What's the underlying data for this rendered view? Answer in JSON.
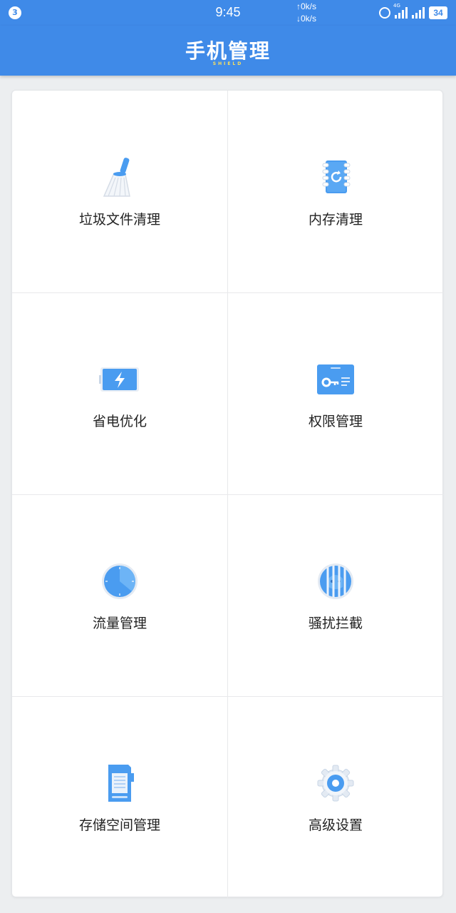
{
  "status_bar": {
    "notification_count": "3",
    "time": "9:45",
    "upload_speed": "↑0k/s",
    "download_speed": "↓0k/s",
    "network_type": "4G",
    "battery": "34"
  },
  "header": {
    "title": "手机管理",
    "subtitle": "SHIELD"
  },
  "colors": {
    "accent": "#3f8ae8",
    "icon_blue": "#4a9cf0",
    "subtitle_yellow": "#ffe15a"
  },
  "tiles": [
    {
      "label": "垃圾文件清理",
      "icon": "broom-icon"
    },
    {
      "label": "内存清理",
      "icon": "memory-notebook-icon"
    },
    {
      "label": "省电优化",
      "icon": "battery-bolt-icon"
    },
    {
      "label": "权限管理",
      "icon": "key-card-icon"
    },
    {
      "label": "流量管理",
      "icon": "data-clock-icon"
    },
    {
      "label": "骚扰拦截",
      "icon": "block-cage-icon"
    },
    {
      "label": "存储空间管理",
      "icon": "sd-card-icon"
    },
    {
      "label": "高级设置",
      "icon": "gear-icon"
    }
  ]
}
